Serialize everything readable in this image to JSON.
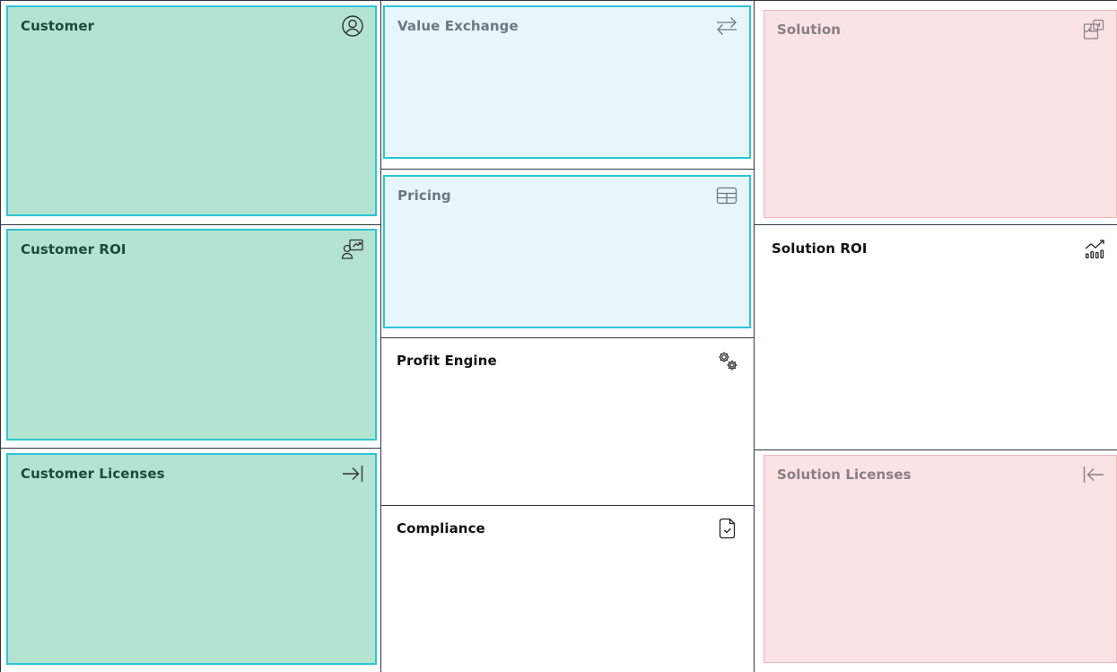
{
  "colors": {
    "customer_fill": "#b4e3cf",
    "accent_border": "#2bc6d8",
    "value_fill": "#e6f6fa",
    "solution_fill": "#f9e3e4",
    "solution_border": "#f2b7bb"
  },
  "customer": {
    "title": "Customer",
    "icon": "user-circle-icon"
  },
  "customer_roi": {
    "title": "Customer ROI",
    "icon": "user-presentation-icon"
  },
  "customer_licenses": {
    "title": "Customer Licenses",
    "icon": "arrow-right-to-bar-icon"
  },
  "value_exchange": {
    "title": "Value Exchange",
    "icon": "arrows-exchange-icon"
  },
  "pricing": {
    "title": "Pricing",
    "icon": "table-icon"
  },
  "profit_engine": {
    "title": "Profit Engine",
    "icon": "gears-icon"
  },
  "compliance": {
    "title": "Compliance",
    "icon": "document-check-icon"
  },
  "solution": {
    "title": "Solution",
    "icon": "puzzle-icon"
  },
  "solution_roi": {
    "title": "Solution ROI",
    "icon": "chart-growth-icon"
  },
  "solution_licenses": {
    "title": "Solution Licenses",
    "icon": "bar-arrow-left-icon"
  }
}
